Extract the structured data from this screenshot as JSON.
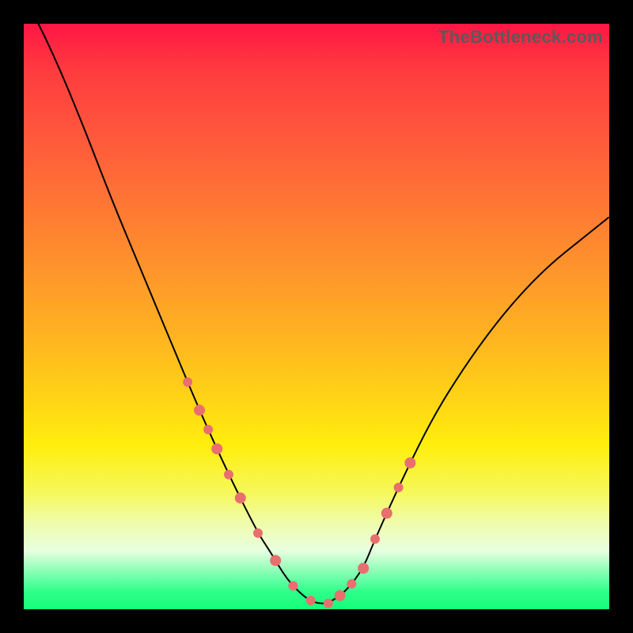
{
  "watermark": "TheBottleneck.com",
  "chart_data": {
    "type": "line",
    "title": "",
    "xlabel": "",
    "ylabel": "",
    "xlim": [
      0,
      100
    ],
    "ylim": [
      0,
      100
    ],
    "grid": false,
    "legend": false,
    "series": [
      {
        "name": "bottleneck-curve",
        "x": [
          0,
          5,
          10,
          15,
          20,
          25,
          30,
          35,
          40,
          42,
          45,
          48,
          50,
          52,
          55,
          58,
          60,
          65,
          70,
          75,
          80,
          85,
          90,
          95,
          100
        ],
        "values": [
          105,
          95,
          83,
          70,
          58,
          46,
          34,
          23,
          13,
          10,
          5,
          2,
          1,
          1,
          3,
          7,
          12,
          23,
          33,
          41,
          48,
          54,
          59,
          63,
          67
        ]
      }
    ],
    "annotations": {
      "left_bead_cluster_x": [
        28,
        30,
        31.5,
        33,
        35,
        37,
        40,
        43,
        46,
        49
      ],
      "left_bead_radius": [
        6,
        7,
        6,
        7,
        6,
        7,
        6,
        7,
        6,
        6
      ],
      "right_bead_cluster_x": [
        52,
        54,
        56,
        58,
        60,
        62,
        64,
        66
      ],
      "right_bead_radius": [
        6,
        7,
        6,
        7,
        6,
        7,
        6,
        7
      ],
      "bead_color": "#e96f6f"
    },
    "background_gradient_stops": [
      {
        "pos": 0,
        "color": "#ff1744"
      },
      {
        "pos": 50,
        "color": "#ff9a2a"
      },
      {
        "pos": 75,
        "color": "#ffee0d"
      },
      {
        "pos": 95,
        "color": "#7dffb0"
      },
      {
        "pos": 100,
        "color": "#15ff7a"
      }
    ]
  }
}
